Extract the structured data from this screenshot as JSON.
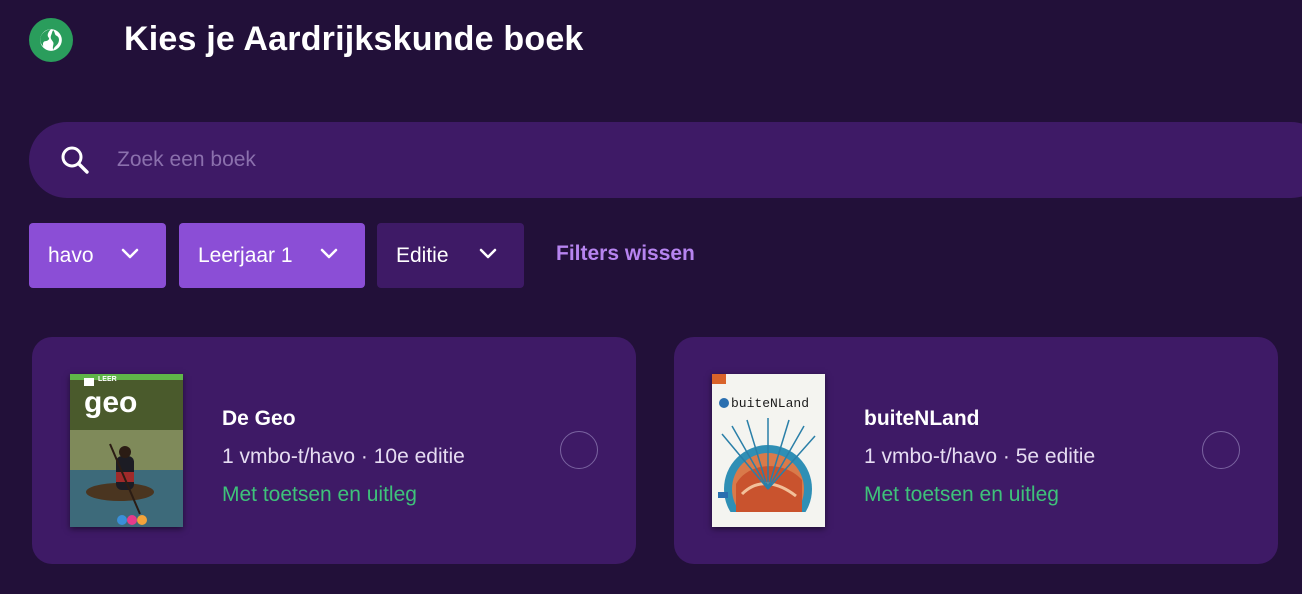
{
  "header": {
    "title": "Kies je Aardrijkskunde boek",
    "icon": "globe-icon",
    "icon_color": "#2a9d5c"
  },
  "search": {
    "placeholder": "Zoek een boek",
    "value": "",
    "icon": "search-icon"
  },
  "filters": [
    {
      "label": "havo",
      "active": true
    },
    {
      "label": "Leerjaar 1",
      "active": true
    },
    {
      "label": "Editie",
      "active": false
    }
  ],
  "clear_filters_label": "Filters wissen",
  "books": [
    {
      "title": "De Geo",
      "meta": "1 vmbo-t/havo · 10e editie",
      "tag": "Met toetsen en uitleg",
      "cover_text": "geo",
      "cover_badge": "LEER",
      "selected": false
    },
    {
      "title": "buiteNLand",
      "meta": "1 vmbo-t/havo · 5e editie",
      "tag": "Met toetsen en uitleg",
      "cover_text": "buiteNLand",
      "selected": false
    }
  ],
  "colors": {
    "background": "#221039",
    "surface": "#3e1a66",
    "accent": "#8b4ed6",
    "link": "#b784f0",
    "success": "#3ec27a"
  }
}
